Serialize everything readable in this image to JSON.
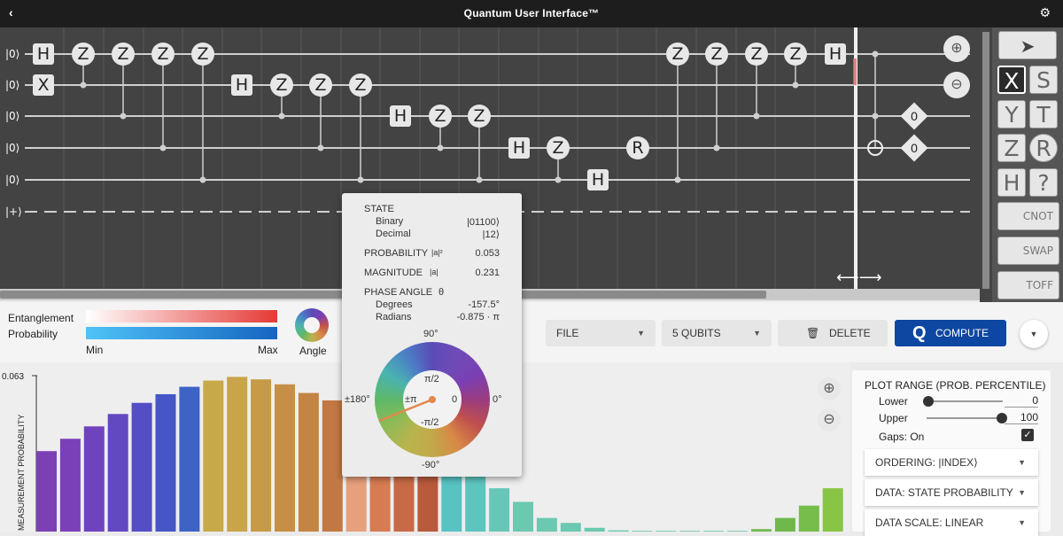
{
  "app": {
    "title": "Quantum User Interface™",
    "back_icon": "chevron-left-icon",
    "settings_icon": "gear-icon"
  },
  "circuit": {
    "wire_labels": [
      "|0⟩",
      "|0⟩",
      "|0⟩",
      "|0⟩",
      "|0⟩",
      "|+⟩"
    ],
    "measure_values": [
      "0",
      "0"
    ]
  },
  "toolbox": {
    "items": [
      {
        "label": "X",
        "selected": true
      },
      {
        "label": "S"
      },
      {
        "label": "Y"
      },
      {
        "label": "T"
      },
      {
        "label": "Z"
      },
      {
        "label": "R"
      },
      {
        "label": "H"
      },
      {
        "label": "?"
      }
    ],
    "cnot": "CNOT",
    "swap": "SWAP",
    "toff": "TOFF"
  },
  "legend": {
    "entanglement": "Entanglement",
    "probability": "Probability",
    "min": "Min",
    "max": "Max",
    "angle": "Angle",
    "colors": {
      "entanglement_end": "#e53935",
      "probability_end": "#1565c0",
      "probability_start": "#4fc3f7"
    }
  },
  "controls": {
    "file": "FILE",
    "qubits": "5 QUBITS",
    "delete": "DELETE",
    "compute": "COMPUTE",
    "compute_color": "#0d47a1"
  },
  "tooltip": {
    "state": "STATE",
    "binary_label": "Binary",
    "binary_value": "|01100⟩",
    "decimal_label": "Decimal",
    "decimal_value": "|12⟩",
    "probability_label": "PROBABILITY",
    "probability_sub": "|a|²",
    "probability_value": "0.053",
    "magnitude_label": "MAGNITUDE",
    "magnitude_sub": "|a|",
    "magnitude_value": "0.231",
    "phase_label": "PHASE ANGLE",
    "phase_sub": "θ",
    "degrees_label": "Degrees",
    "degrees_value": "-157.5°",
    "radians_label": "Radians",
    "radians_value": "-0.875 · π",
    "wheel_top": "90°",
    "wheel_bottom": "-90°",
    "wheel_left": "±180°",
    "wheel_right": "0°",
    "inner_top": "π/2",
    "inner_bottom": "-π/2",
    "inner_left": "±π",
    "inner_right": "0"
  },
  "plot_options": {
    "title": "PLOT RANGE (PROB. PERCENTILE)",
    "lower_label": "Lower",
    "lower_value": "0",
    "upper_label": "Upper",
    "upper_value": "100",
    "gaps_label": "Gaps: On",
    "gaps_checked": true,
    "ordering": "ORDERING: |INDEX⟩",
    "data": "DATA: STATE PROBABILITY",
    "scale": "DATA SCALE: LINEAR"
  },
  "chart_data": {
    "type": "bar",
    "ylabel": "MEASUREMENT PROBABILITY",
    "ytick": "0.063",
    "ymax": 0.063,
    "values": [
      0.0325,
      0.0375,
      0.0425,
      0.0475,
      0.052,
      0.0555,
      0.0585,
      0.061,
      0.0625,
      0.0615,
      0.0595,
      0.056,
      0.053,
      0.05,
      0.046,
      0.042,
      0.037,
      0.031,
      0.025,
      0.0175,
      0.012,
      0.0055,
      0.0035,
      0.0015,
      0.0005,
      0.0003,
      0.0003,
      0.0003,
      0.0003,
      0.0003,
      0.001,
      0.0055,
      0.0105,
      0.0175
    ],
    "colors": [
      "#7a40b4",
      "#7a40b8",
      "#6f43be",
      "#6248c2",
      "#534dc6",
      "#4656c6",
      "#3d63c6",
      "#c7a94a",
      "#c9a44a",
      "#c79a47",
      "#c68f45",
      "#c48444",
      "#c27843",
      "#e6a07c",
      "#d67b52",
      "#c86a45",
      "#b95a3d",
      "#57c3c2",
      "#5cc5be",
      "#66c7b8",
      "#6ac9b0",
      "#6ac9b0",
      "#6ac9b0",
      "#6ac9b0",
      "#6ac9b0",
      "#6ac9b0",
      "#6ac9b0",
      "#6ac9b0",
      "#6ac9b0",
      "#6ac9b0",
      "#74b950",
      "#6fb84c",
      "#77bd4b",
      "#88c545"
    ]
  }
}
